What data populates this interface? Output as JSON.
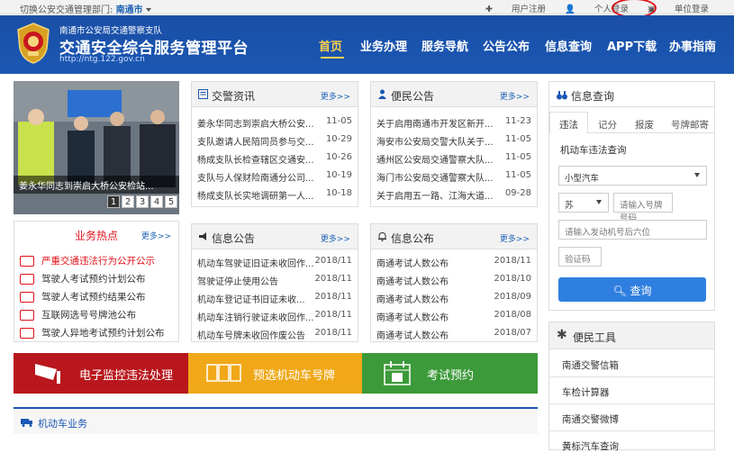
{
  "topbar": {
    "switch_label": "切换公安交通管理部门:",
    "city": "南通市",
    "links": [
      "用户注册",
      "个人登录",
      "单位登录"
    ]
  },
  "header": {
    "subtitle": "南通市公安局交通警察支队",
    "title": "交通安全综合服务管理平台",
    "url": "http://ntg.122.gov.cn",
    "nav": [
      "首页",
      "业务办理",
      "服务导航",
      "公告公布",
      "信息查询",
      "APP下载",
      "办事指南"
    ]
  },
  "slider": {
    "caption": "姜永华同志到崇启大桥公安检站...",
    "pages": [
      "1",
      "2",
      "3",
      "4",
      "5"
    ]
  },
  "more_label": "更多>>",
  "news": {
    "title": "交警资讯",
    "items": [
      {
        "text": "姜永华同志到崇启大桥公安...",
        "date": "11-05"
      },
      {
        "text": "支队邀请人民陪同员参与交...",
        "date": "10-29"
      },
      {
        "text": "杨成支队长检查辖区交通安...",
        "date": "10-26"
      },
      {
        "text": "支队与人保财险南通分公司...",
        "date": "10-19"
      },
      {
        "text": "杨成支队长实地调研第一人...",
        "date": "10-18"
      }
    ]
  },
  "notice": {
    "title": "便民公告",
    "items": [
      {
        "text": "关于启用南通市开发区新开...",
        "date": "11-23"
      },
      {
        "text": "海安市公安局交警大队关于...",
        "date": "11-05"
      },
      {
        "text": "通州区公安局交通警察大队...",
        "date": "11-05"
      },
      {
        "text": "海门市公安局交通警察大队...",
        "date": "11-05"
      },
      {
        "text": "关于启用五一路、江海大道...",
        "date": "09-28"
      }
    ]
  },
  "hot": {
    "title": "业务热点",
    "items": [
      "严重交通违法行为公开公示",
      "驾驶人考试预约计划公布",
      "驾驶人考试预约结果公布",
      "互联网选号号牌池公布",
      "驾驶人异地考试预约计划公布"
    ]
  },
  "info_notice": {
    "title": "信息公告",
    "items": [
      {
        "text": "机动车驾驶证旧证未收回作...",
        "date": "2018/11"
      },
      {
        "text": "驾驶证停止使用公告",
        "date": "2018/11"
      },
      {
        "text": "机动车登记证书旧证未收...",
        "date": "2018/11"
      },
      {
        "text": "机动车注销行驶证未收回作...",
        "date": "2018/11"
      },
      {
        "text": "机动车号牌未收回作废公告",
        "date": "2018/11"
      }
    ]
  },
  "info_publish": {
    "title": "信息公布",
    "items": [
      {
        "text": "南通考试人数公布",
        "date": "2018/11"
      },
      {
        "text": "南通考试人数公布",
        "date": "2018/10"
      },
      {
        "text": "南通考试人数公布",
        "date": "2018/09"
      },
      {
        "text": "南通考试人数公布",
        "date": "2018/08"
      },
      {
        "text": "南通考试人数公布",
        "date": "2018/07"
      }
    ]
  },
  "banners": [
    {
      "label": "电子监控违法处理",
      "color": "#b8171d"
    },
    {
      "label": "预选机动车号牌",
      "color": "#f0a818"
    },
    {
      "label": "考试预约",
      "color": "#3c9a3a"
    }
  ],
  "section": {
    "title": "机动车业务"
  },
  "query": {
    "title": "信息查询",
    "tabs": [
      "违法",
      "记分",
      "报废",
      "号牌邮寄"
    ],
    "subtitle": "机动车违法查询",
    "vehicle_type": "小型汽车",
    "province": "苏",
    "plate_placeholder": "请输入号牌号码",
    "engine_placeholder": "请输入发动机号后六位",
    "captcha_placeholder": "验证码",
    "button": "查询"
  },
  "tools": {
    "title": "便民工具",
    "items": [
      "南通交警信箱",
      "车检计算器",
      "南通交警微博",
      "黄标汽车查询"
    ]
  },
  "colors": {
    "brand_blue": "#1b57b3",
    "accent_yellow": "#ffd24a",
    "hot_red": "#e0121a"
  }
}
